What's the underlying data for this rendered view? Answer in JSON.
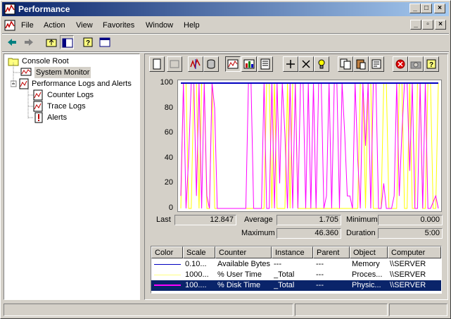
{
  "window": {
    "title": "Performance"
  },
  "menu": [
    "File",
    "Action",
    "View",
    "Favorites",
    "Window",
    "Help"
  ],
  "tree": {
    "root": "Console Root",
    "system_monitor": "System Monitor",
    "logs": "Performance Logs and Alerts",
    "counter_logs": "Counter Logs",
    "trace_logs": "Trace Logs",
    "alerts": "Alerts"
  },
  "stats": {
    "last_label": "Last",
    "last": "12.847",
    "avg_label": "Average",
    "avg": "1.705",
    "min_label": "Minimum",
    "min": "0.000",
    "max_label": "Maximum",
    "max": "46.360",
    "dur_label": "Duration",
    "dur": "5:00"
  },
  "legend": {
    "headers": [
      "Color",
      "Scale",
      "Counter",
      "Instance",
      "Parent",
      "Object",
      "Computer"
    ],
    "rows": [
      {
        "color": "#0000c0",
        "scale": "0.10...",
        "counter": "Available Bytes",
        "instance": "---",
        "parent": "---",
        "object": "Memory",
        "computer": "\\\\SERVER"
      },
      {
        "color": "#ffff80",
        "scale": "1000...",
        "counter": "% User Time",
        "instance": "_Total",
        "parent": "---",
        "object": "Proces...",
        "computer": "\\\\SERVER"
      },
      {
        "color": "#ff00ff",
        "scale": "100....",
        "counter": "% Disk Time",
        "instance": "_Total",
        "parent": "---",
        "object": "Physic...",
        "computer": "\\\\SERVER"
      }
    ]
  },
  "chart_data": {
    "type": "line",
    "ylim": [
      0,
      100
    ],
    "yticks": [
      "100",
      "80",
      "60",
      "40",
      "20",
      "0"
    ],
    "series": [
      {
        "name": "Available Bytes",
        "color": "#0000c0",
        "values": [
          100,
          100,
          100,
          100,
          100,
          100,
          100,
          100,
          100,
          100,
          100,
          100,
          100,
          100,
          100,
          100,
          100,
          100,
          100,
          100,
          100,
          100,
          100,
          100,
          100,
          100,
          100,
          100,
          100,
          100,
          100,
          100,
          100,
          100,
          100,
          100,
          100,
          100,
          100,
          100,
          100,
          100,
          100,
          100,
          100,
          100,
          100,
          100,
          100,
          100,
          100,
          100,
          100,
          100,
          100,
          100,
          100,
          100,
          100,
          100,
          100,
          100,
          100,
          100,
          100,
          100,
          100,
          100,
          100,
          100,
          100,
          100,
          100,
          100,
          100,
          100,
          100,
          100,
          100,
          100,
          100,
          100,
          100,
          100,
          100,
          100,
          100,
          100,
          100,
          100,
          100,
          100,
          100,
          100,
          100,
          100,
          100,
          100,
          100,
          100
        ]
      },
      {
        "name": "% User Time",
        "color": "#ffff00",
        "values": [
          0,
          100,
          100,
          0,
          0,
          100,
          100,
          0,
          100,
          100,
          0,
          0,
          100,
          0,
          0,
          0,
          0,
          0,
          0,
          0,
          0,
          0,
          0,
          0,
          0,
          0,
          0,
          0,
          0,
          0,
          0,
          0,
          0,
          100,
          100,
          0,
          100,
          0,
          0,
          0,
          0,
          100,
          0,
          100,
          100,
          0,
          0,
          0,
          0,
          0,
          0,
          0,
          0,
          0,
          0,
          0,
          0,
          0,
          0,
          0,
          0,
          0,
          0,
          0,
          0,
          0,
          0,
          0,
          0,
          100,
          100,
          0,
          100,
          100,
          0,
          0,
          0,
          0,
          100,
          100,
          0,
          0,
          0,
          0,
          100,
          100,
          0,
          0,
          100,
          0,
          0,
          100,
          100,
          0,
          0,
          100,
          100,
          0,
          0,
          100
        ]
      },
      {
        "name": "% Disk Time",
        "color": "#ff00ff",
        "values": [
          10,
          100,
          0,
          40,
          100,
          100,
          10,
          100,
          0,
          100,
          10,
          0,
          100,
          80,
          0,
          0,
          0,
          0,
          0,
          0,
          0,
          0,
          0,
          0,
          0,
          0,
          100,
          100,
          0,
          0,
          0,
          0,
          100,
          0,
          0,
          100,
          0,
          100,
          20,
          100,
          60,
          0,
          100,
          0,
          100,
          0,
          100,
          100,
          0,
          100,
          0,
          100,
          0,
          100,
          100,
          0,
          10,
          100,
          0,
          100,
          100,
          0,
          100,
          60,
          10,
          10,
          0,
          100,
          40,
          0,
          100,
          50,
          100,
          0,
          100,
          100,
          0,
          0,
          20,
          0,
          0,
          0,
          10,
          100,
          10,
          60,
          100,
          100,
          30,
          100,
          0,
          0,
          100,
          0,
          100,
          0,
          0,
          5,
          10,
          0
        ]
      }
    ]
  }
}
